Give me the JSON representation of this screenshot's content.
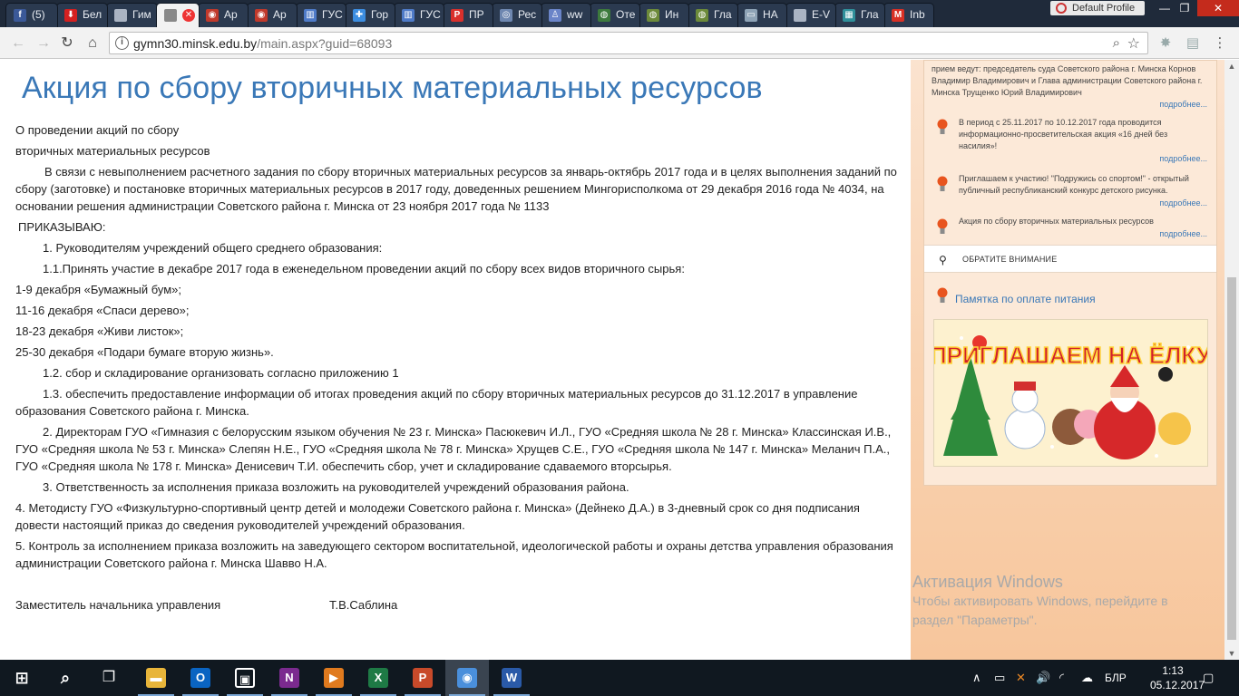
{
  "browser": {
    "tabs": [
      {
        "label": "(5)",
        "icon": "facebook-icon",
        "color": "#3b5998",
        "glyph": "f"
      },
      {
        "label": "Бел",
        "icon": "download-icon",
        "color": "#d42020",
        "glyph": "⬇"
      },
      {
        "label": "Гим",
        "icon": "page-icon",
        "color": "#aab4c3",
        "glyph": ""
      },
      {
        "label": "",
        "icon": "page-icon",
        "color": "#888888",
        "glyph": "",
        "active": true
      },
      {
        "label": "Ар",
        "icon": "ar-icon",
        "color": "#c0392b",
        "glyph": "◉"
      },
      {
        "label": "Ар",
        "icon": "ar-icon",
        "color": "#c0392b",
        "glyph": "◉"
      },
      {
        "label": "ГУС",
        "icon": "gus-icon",
        "color": "#4e7ac7",
        "glyph": "▥"
      },
      {
        "label": "Гор",
        "icon": "gor-icon",
        "color": "#3c8de0",
        "glyph": "✚"
      },
      {
        "label": "ГУС",
        "icon": "gus-icon",
        "color": "#4e7ac7",
        "glyph": "▥"
      },
      {
        "label": "ПР",
        "icon": "pdf-icon",
        "color": "#d9302c",
        "glyph": "P"
      },
      {
        "label": "Рес",
        "icon": "res-icon",
        "color": "#6e87b0",
        "glyph": "◎"
      },
      {
        "label": "ww",
        "icon": "user-icon",
        "color": "#6a84c8",
        "glyph": "♙"
      },
      {
        "label": "Оте",
        "icon": "emblem-icon",
        "color": "#3d7a3d",
        "glyph": "◍"
      },
      {
        "label": "Ин",
        "icon": "emblem-icon",
        "color": "#6c8a3a",
        "glyph": "◍"
      },
      {
        "label": "Гла",
        "icon": "emblem-icon",
        "color": "#6c8a3a",
        "glyph": "◍"
      },
      {
        "label": "НА",
        "icon": "monitor-icon",
        "color": "#8ea3b6",
        "glyph": "▭"
      },
      {
        "label": "E-V",
        "icon": "page-icon",
        "color": "#aab4c3",
        "glyph": ""
      },
      {
        "label": "Гла",
        "icon": "site-icon",
        "color": "#2f8f9a",
        "glyph": "▦"
      },
      {
        "label": "Inb",
        "icon": "gmail-icon",
        "color": "#d93025",
        "glyph": "M"
      }
    ],
    "profile_label": "Default Profile",
    "window_controls": {
      "minimize": "—",
      "maximize": "❐",
      "close": "✕"
    },
    "nav": {
      "back": "←",
      "forward": "→",
      "reload": "↻",
      "home": "⌂"
    },
    "url_host": "gymn30.minsk.edu.by",
    "url_path": "/main.aspx?guid=68093",
    "url_info": "i",
    "zoom_glyph": "⌕",
    "star_glyph": "☆"
  },
  "article": {
    "title": "Акция по сбору вторичных материальных ресурсов",
    "lines": [
      "О проведении акций по сбору",
      "вторичных материальных ресурсов",
      "В связи с невыполнением расчетного задания по сбору вторичных материальных ресурсов за январь-октябрь 2017 года и в целях выполнения заданий по сбору (заготовке) и постановке вторичных материальных ресурсов в 2017 году, доведенных решением Мингорисполкома от 29 декабря 2016 года № 4034, на основании решения администрации Советского района г. Минска от 23 ноября 2017 года № 1133",
      "ПРИКАЗЫВАЮ:",
      "1. Руководителям учреждений общего среднего образования:",
      "1.1.Принять участие в декабре 2017 года в еженедельном проведении акций по сбору всех видов вторичного сырья:",
      "1-9 декабря «Бумажный бум»;",
      "11-16 декабря «Спаси дерево»;",
      "18-23 декабря «Живи листок»;",
      "25-30 декабря «Подари бумаге вторую жизнь».",
      "1.2. сбор и складирование организовать согласно приложению 1",
      "1.3. обеспечить предоставление информации об итогах проведения акций по сбору вторичных материальных ресурсов до 31.12.2017 в управление образования Советского района г. Минска.",
      "2. Директорам ГУО «Гимназия с белорусским языком обучения № 23 г. Минска» Пасюкевич И.Л., ГУО «Средняя школа № 28 г. Минска» Классинская И.В., ГУО «Средняя школа № 53 г. Минска» Слепян Н.Е., ГУО «Средняя школа № 78 г. Минска» Хрущев С.Е., ГУО «Средняя школа № 147 г. Минска» Меланич П.А., ГУО «Средняя школа № 178 г. Минска» Денисевич Т.И. обеспечить сбор, учет и складирование сдаваемого вторсырья.",
      "3. Ответственность за исполнения приказа возложить на руководителей учреждений образования района.",
      "4. Методисту ГУО «Физкультурно-спортивный центр детей и молодежи Советского района г. Минска» (Дейнеко Д.А.) в 3-дневный срок со дня подписания довести настоящий приказ до сведения руководителей учреждений образования.",
      "5. Контроль за исполнением приказа возложить на заведующего сектором воспитательной, идеологической работы и охраны детства управления образования администрации Советского района г. Минска Шавво Н.А."
    ],
    "signature_role": "Заместитель начальника управления",
    "signature_name": "Т.В.Саблина"
  },
  "sidebar": {
    "news": [
      {
        "text": "прием ведут: председатель суда Советского района г. Минска Корнов Владимир Владимирович и Глава администрации Советского района г. Минска Трущенко Юрий Владимирович",
        "more": "подробнее..."
      },
      {
        "text": "В период с 25.11.2017 по 10.12.2017 года проводится информационно-просветительская акция «16 дней без насилия»!",
        "more": "подробнее..."
      },
      {
        "text": "Приглашаем к участию! \"Подружись со спортом!\" - открытый публичный республиканский конкурс детского рисунка.",
        "more": "подробнее..."
      },
      {
        "text": "Акция по сбору вторичных материальных ресурсов",
        "more": "подробнее..."
      }
    ],
    "notice_label": "ОБРАТИТЕ ВНИМАНИЕ",
    "memo_link": "Памятка по оплате питания",
    "banner_text": "ПРИГЛАШАЕМ НА ЁЛКУ",
    "accent_color": "#3a78b7"
  },
  "watermark": {
    "title": "Активация Windows",
    "subtitle": "Чтобы активировать Windows, перейдите в раздел \"Параметры\"."
  },
  "taskbar": {
    "apps": [
      {
        "name": "file-explorer",
        "color": "#e8b53a",
        "glyph": "▬"
      },
      {
        "name": "outlook",
        "color": "#0a64c2",
        "glyph": "O"
      },
      {
        "name": "store",
        "color": "#ffffff",
        "glyph": "▣"
      },
      {
        "name": "onenote",
        "color": "#7b2a8f",
        "glyph": "N"
      },
      {
        "name": "media-player",
        "color": "#e07a1e",
        "glyph": "▶"
      },
      {
        "name": "excel",
        "color": "#1e7a45",
        "glyph": "X"
      },
      {
        "name": "powerpoint",
        "color": "#c84a2a",
        "glyph": "P"
      },
      {
        "name": "chrome",
        "color": "#4a8fdb",
        "glyph": "◉",
        "active": true
      },
      {
        "name": "word",
        "color": "#2a5aa8",
        "glyph": "W"
      }
    ],
    "start_glyph": "⊞",
    "search_glyph": "⌕",
    "taskview_glyph": "❐",
    "tray": {
      "chevron": "∧",
      "battery": "▭",
      "volume": "🔊",
      "network": "◜",
      "cloud": "☁",
      "lang": "БЛР",
      "notify": "▢"
    },
    "time": "1:13",
    "date": "05.12.2017"
  }
}
